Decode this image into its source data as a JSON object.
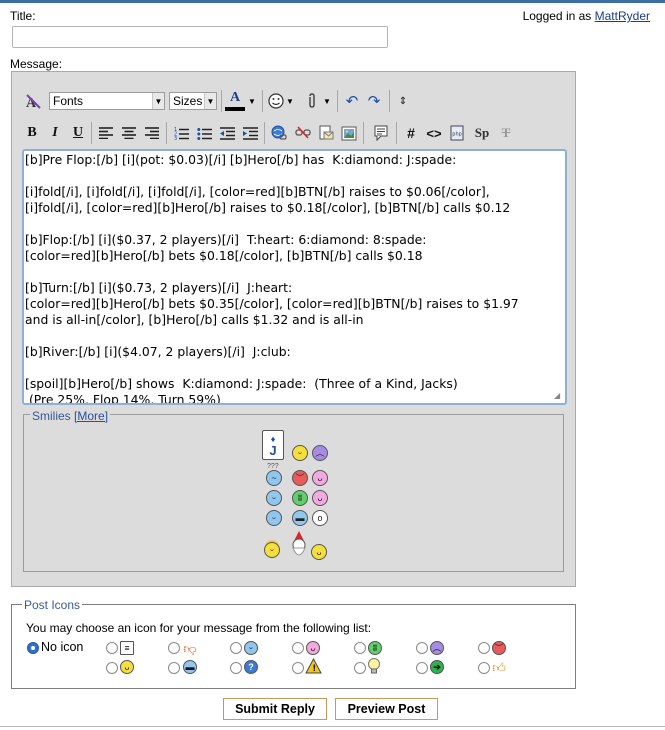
{
  "header": {
    "title_label": "Title:",
    "logged_in_prefix": "Logged in as",
    "username": "MattRyder",
    "message_label": "Message:"
  },
  "toolbar": {
    "font_select": "Fonts",
    "size_select": "Sizes"
  },
  "message": {
    "text": "[b]Pre Flop:[/b] [i](pot: $0.03)[/i] [b]Hero[/b] has  K:diamond: J:spade:\n\n[i]fold[/i], [i]fold[/i], [i]fold[/i], [color=red][b]BTN[/b] raises to $0.06[/color],\n[i]fold[/i], [color=red][b]Hero[/b] raises to $0.18[/color], [b]BTN[/b] calls $0.12\n\n[b]Flop:[/b] [i]($0.37, 2 players)[/i]  T:heart: 6:diamond: 8:spade:\n[color=red][b]Hero[/b] bets $0.18[/color], [b]BTN[/b] calls $0.18\n\n[b]Turn:[/b] [i]($0.73, 2 players)[/i]  J:heart:\n[color=red][b]Hero[/b] bets $0.35[/color], [color=red][b]BTN[/b] raises to $1.97\nand is all-in[/color], [b]Hero[/b] calls $1.32 and is all-in\n\n[b]River:[/b] [i]($4.07, 2 players)[/i]  J:club:\n\n[spoil][b]Hero[/b] shows  K:diamond: J:spade:  (Three of a Kind, Jacks)\n (Pre 25%, Flop 14%, Turn 59%)"
  },
  "smilies": {
    "legend": "Smilies",
    "more_link": "[More]"
  },
  "post_icons": {
    "legend": "Post Icons",
    "description": "You may choose an icon for your message from the following list:",
    "no_icon_label": "No icon"
  },
  "buttons": {
    "submit": "Submit Reply",
    "preview": "Preview Post"
  }
}
